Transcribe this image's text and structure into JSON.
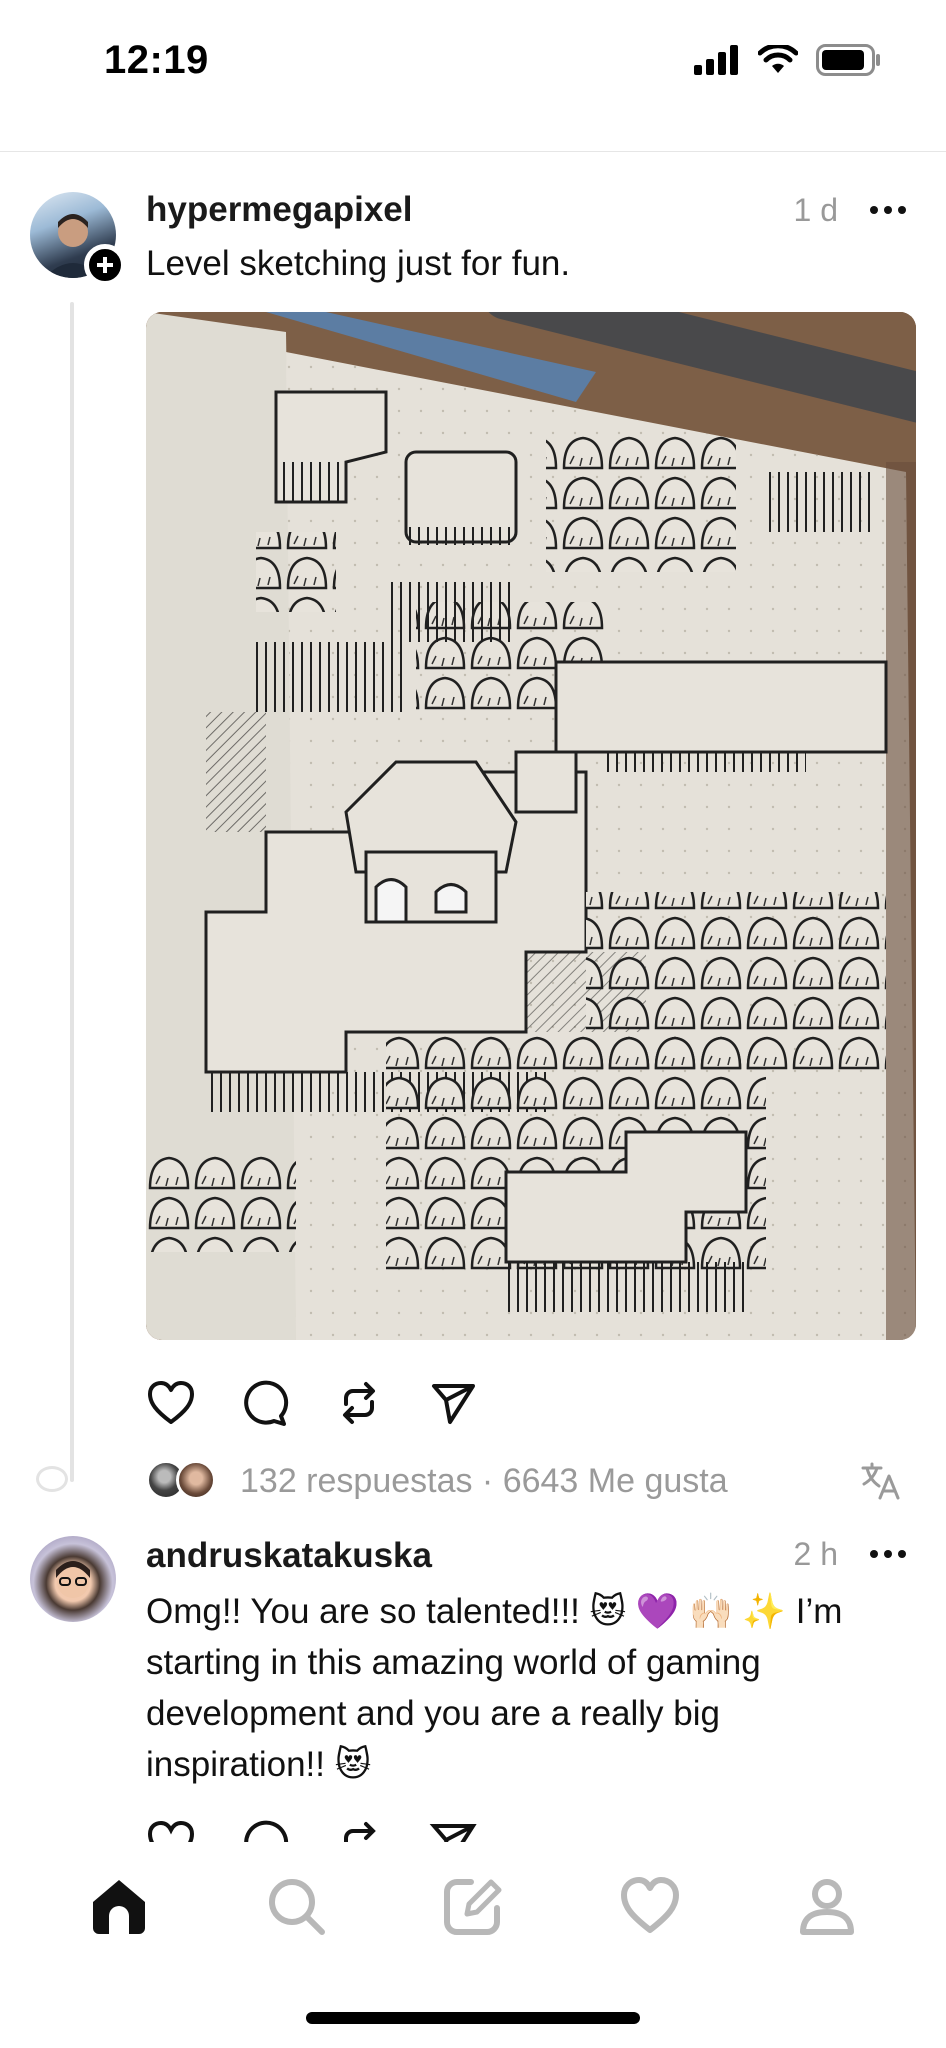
{
  "status_bar": {
    "time": "12:19",
    "icons": [
      "cellular-signal-icon",
      "wifi-icon",
      "battery-icon"
    ]
  },
  "post": {
    "username": "hypermegapixel",
    "time": "1 d",
    "text": "Level sketching just for fun.",
    "image_description_icon": "photo",
    "actions": [
      "heart-icon",
      "comment-icon",
      "repost-icon",
      "send-icon"
    ],
    "stats": "132 respuestas · 6643 Me gusta"
  },
  "reply": {
    "username": "andruskatakuska",
    "time": "2 h",
    "text": "Omg!! You are so talented!!! 😻 💜 🙌🏻 ✨ I’m starting in this amazing world of gaming development and you are a really big inspiration!! 😻"
  },
  "tab_bar": {
    "items": [
      "home-icon",
      "search-icon",
      "compose-icon",
      "activity-heart-icon",
      "profile-icon"
    ],
    "active": "home-icon"
  },
  "colors": {
    "text": "#111111",
    "muted": "#999999",
    "line": "#e3e3e3",
    "tab_inactive": "#b8b8b8"
  }
}
